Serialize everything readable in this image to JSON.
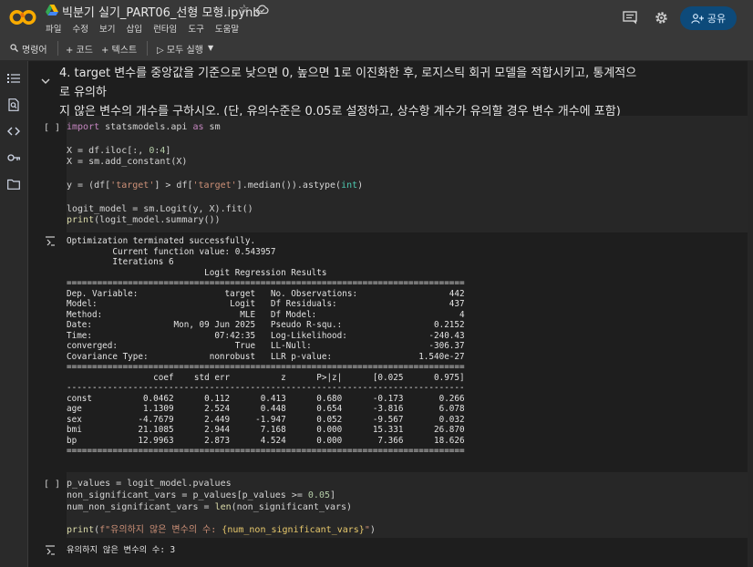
{
  "header": {
    "title": "빅분기 실기_PART06_선형 모형.ipynb",
    "menu": [
      "파일",
      "수정",
      "보기",
      "삽입",
      "런타임",
      "도구",
      "도움말"
    ],
    "share_label": "공유"
  },
  "toolbar": {
    "commands_label": "명령어",
    "add_code_label": "+ 코드",
    "add_text_label": "+ 텍스트",
    "run_all_label": "▷ 모두 실행"
  },
  "markdown": {
    "line1": "4. target 변수를 중앙값을 기준으로 낮으면 0, 높으면 1로 이진화한 후, 로지스틱 회귀 모델을 적합시키고, 통계적으로 유의하",
    "line2": "지 않은 변수의 개수를 구하시오. (단, 유의수준은 0.05로 설정하고, 상수항 계수가 유의할 경우 변수 개수에 포함)"
  },
  "cell1": {
    "bracket": "[ ]",
    "code": [
      [
        [
          "k",
          "import"
        ],
        [
          "v",
          " statsmodels.api "
        ],
        [
          "k",
          "as"
        ],
        [
          "v",
          " sm"
        ]
      ],
      [],
      [
        [
          "v",
          "X = df.iloc["
        ],
        [
          "v",
          ":, "
        ],
        [
          "n",
          "0"
        ],
        [
          "v",
          ":"
        ],
        [
          "n",
          "4"
        ],
        [
          "v",
          "]"
        ]
      ],
      [
        [
          "v",
          "X = sm.add_constant(X)"
        ]
      ],
      [],
      [
        [
          "v",
          "y = (df["
        ],
        [
          "s",
          "'target'"
        ],
        [
          "v",
          "] > df["
        ],
        [
          "s",
          "'target'"
        ],
        [
          "v",
          "].median()).astype("
        ],
        [
          "b",
          "int"
        ],
        [
          "v",
          ")"
        ]
      ],
      [],
      [
        [
          "v",
          "logit_model = sm.Logit(y, X).fit()"
        ]
      ],
      [
        [
          "f",
          "print"
        ],
        [
          "v",
          "(logit_model.summary())"
        ]
      ]
    ]
  },
  "output1": {
    "lines": [
      "Optimization terminated successfully.",
      "         Current function value: 0.543957",
      "         Iterations 6",
      "                           Logit Regression Results",
      "==============================================================================",
      "Dep. Variable:                 target   No. Observations:                  442",
      "Model:                          Logit   Df Residuals:                      437",
      "Method:                           MLE   Df Model:                            4",
      "Date:                Mon, 09 Jun 2025   Pseudo R-squ.:                  0.2152",
      "Time:                        07:42:35   Log-Likelihood:                -240.43",
      "converged:                       True   LL-Null:                       -306.37",
      "Covariance Type:            nonrobust   LLR p-value:                 1.540e-27",
      "==============================================================================",
      "                 coef    std err          z      P>|z|      [0.025      0.975]",
      "------------------------------------------------------------------------------",
      "const          0.0462      0.112      0.413      0.680      -0.173       0.266",
      "age            1.1309      2.524      0.448      0.654      -3.816       6.078",
      "sex           -4.7679      2.449     -1.947      0.052      -9.567       0.032",
      "bmi           21.1085      2.944      7.168      0.000      15.331      26.870",
      "bp            12.9963      2.873      4.524      0.000       7.366      18.626",
      "=============================================================================="
    ]
  },
  "cell2": {
    "bracket": "[ ]",
    "code": [
      [
        [
          "v",
          "p_values = logit_model.pvalues"
        ]
      ],
      [
        [
          "v",
          "non_significant_vars = p_values[p_values >= "
        ],
        [
          "n",
          "0.05"
        ],
        [
          "v",
          "]"
        ]
      ],
      [
        [
          "v",
          "num_non_significant_vars = "
        ],
        [
          "f",
          "len"
        ],
        [
          "v",
          "(non_significant_vars)"
        ]
      ],
      [],
      [
        [
          "f",
          "print"
        ],
        [
          "v",
          "("
        ],
        [
          "s",
          "f\"유의하지 않은 변수의 수: "
        ],
        [
          "y",
          "{num_non_significant_vars}"
        ],
        [
          "s",
          "\""
        ],
        [
          "v",
          ")"
        ]
      ]
    ]
  },
  "output2": {
    "lines": [
      "유의하지 않은 변수의 수: 3"
    ]
  },
  "icons": {
    "sidebar": [
      "toc-icon",
      "find-icon",
      "code-snippets-icon",
      "secrets-key-icon",
      "files-folder-icon"
    ]
  }
}
